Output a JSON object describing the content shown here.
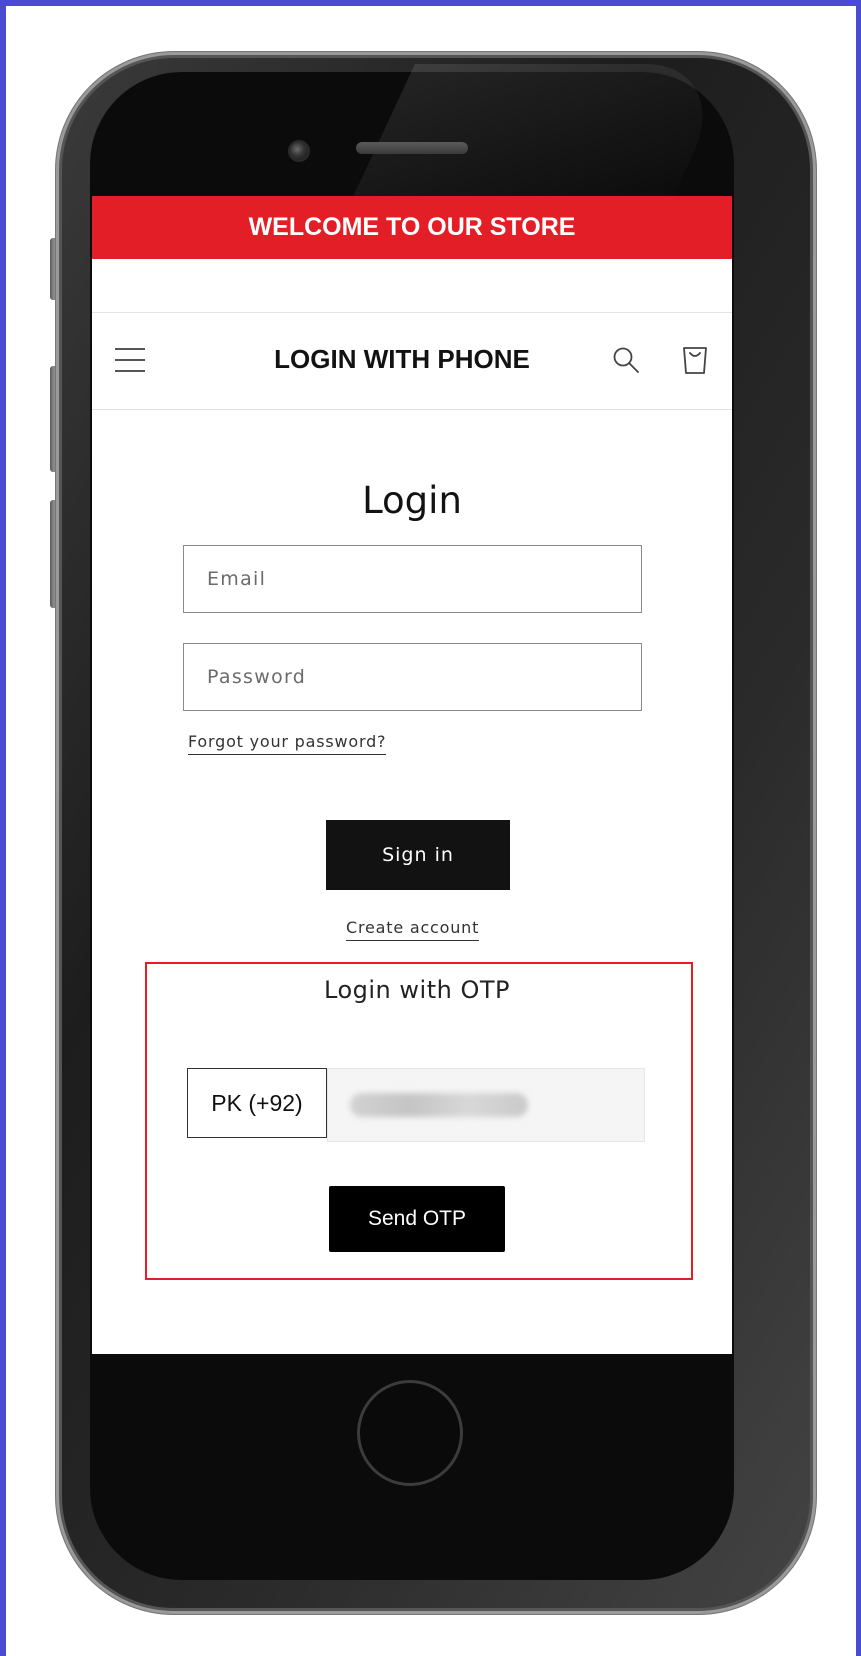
{
  "banner": {
    "text": "WELCOME TO OUR STORE"
  },
  "header": {
    "title": "LOGIN WITH PHONE",
    "menu_icon": "hamburger-menu-icon",
    "search_icon": "search-icon",
    "cart_icon": "cart-icon"
  },
  "login": {
    "title": "Login",
    "email_placeholder": "Email",
    "password_placeholder": "Password",
    "forgot_link": "Forgot your password?",
    "signin_label": "Sign in",
    "create_account_link": "Create account"
  },
  "otp": {
    "title": "Login with OTP",
    "country_code": "PK (+92)",
    "send_label": "Send OTP",
    "highlight_color": "#e41e26"
  },
  "colors": {
    "banner": "#e41e26",
    "button": "#121212",
    "frame": "#4a4ad2"
  }
}
